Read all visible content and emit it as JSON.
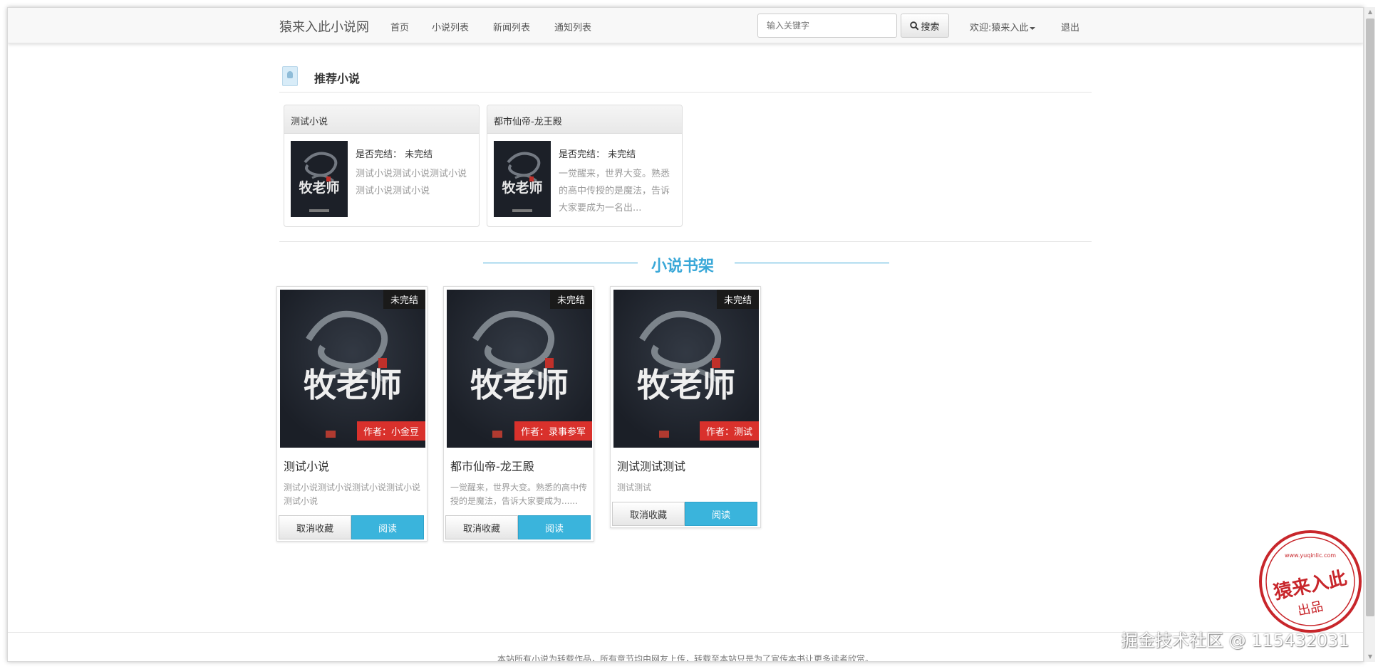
{
  "navbar": {
    "brand": "猿来入此小说网",
    "links": [
      "首页",
      "小说列表",
      "新闻列表",
      "通知列表"
    ],
    "search_placeholder": "输入关键字",
    "search_button": "搜索",
    "welcome": "欢迎:猿来入此",
    "logout": "退出"
  },
  "recommended": {
    "title": "推荐小说",
    "items": [
      {
        "title": "测试小说",
        "status": "是否完结：  未完结",
        "desc": "测试小说测试小说测试小说测试小说测试小说"
      },
      {
        "title": "都市仙帝-龙王殿",
        "status": "是否完结：  未完结",
        "desc": "一觉醒来，世界大变。熟悉的高中传授的是魔法，告诉大家要成为一名出..."
      }
    ]
  },
  "shelf": {
    "title": "小说书架",
    "items": [
      {
        "badge": "未完结",
        "author": "作者：小金豆",
        "name": "测试小说",
        "desc": "测试小说测试小说测试小说测试小说测试小说",
        "cancel": "取消收藏",
        "read": "阅读"
      },
      {
        "badge": "未完结",
        "author": "作者：录事参军",
        "name": "都市仙帝-龙王殿",
        "desc": "一觉醒来，世界大变。熟悉的高中传授的是魔法，告诉大家要成为......",
        "cancel": "取消收藏",
        "read": "阅读"
      },
      {
        "badge": "未完结",
        "author": "作者：测试",
        "name": "测试测试测试",
        "desc": "测试测试",
        "cancel": "取消收藏",
        "read": "阅读"
      }
    ]
  },
  "cover": {
    "calligraphy": "牧老师",
    "seal": "乱"
  },
  "footer": "本站所有小说为转载作品，所有章节均由网友上传，转载至本站只是为了宣传本书让更多读者欣赏。",
  "stamp": {
    "text": "猿来入此",
    "sub": "出品",
    "url": "www.yuqinlic.com"
  },
  "watermark": "掘金技术社区 @ 115432031"
}
